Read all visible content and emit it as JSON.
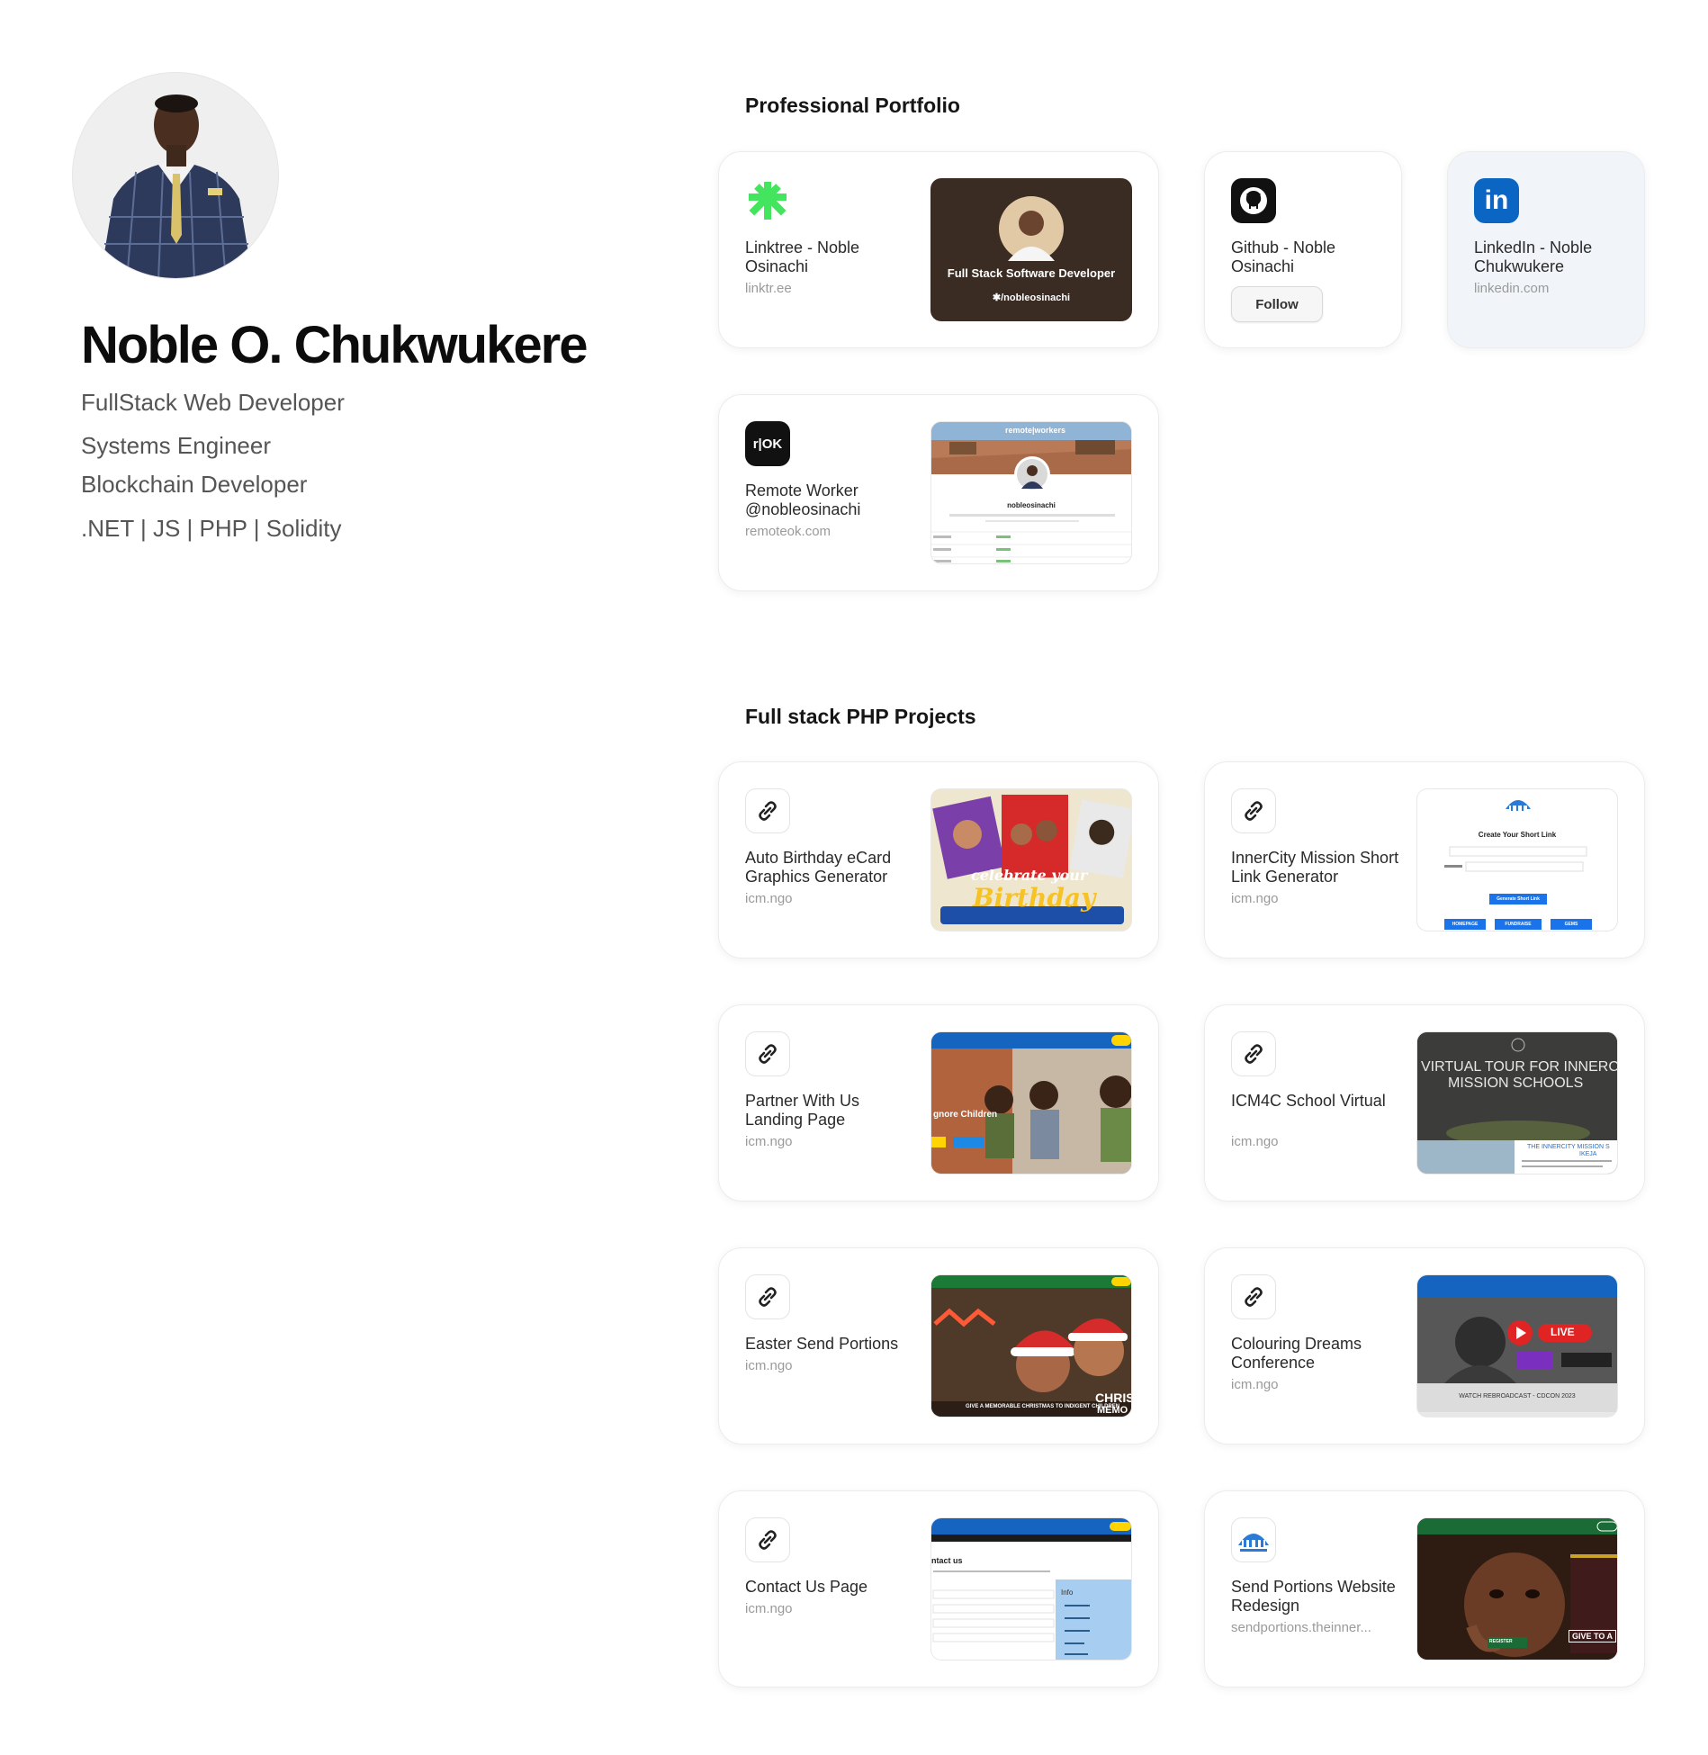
{
  "profile": {
    "name": "Noble O. Chukwukere",
    "bio": [
      "FullStack Web Developer",
      "Systems Engineer",
      "Blockchain Developer",
      ".NET | JS | PHP | Solidity"
    ]
  },
  "sections": {
    "portfolio_title": "Professional Portfolio",
    "php_title": "Full stack PHP Projects"
  },
  "portfolio": [
    {
      "title": "Linktree - Noble Osinachi",
      "domain": "linktr.ee",
      "icon": "linktree-icon",
      "thumb_text": [
        "Full Stack Software Developer",
        "✱/nobleosinachi"
      ]
    },
    {
      "title": "Github - Noble Osinachi",
      "icon": "github-icon",
      "button": "Follow"
    },
    {
      "title": "LinkedIn - Noble Chukwukere",
      "domain": "linkedin.com",
      "icon": "linkedin-icon",
      "icon_text": "in"
    },
    {
      "title": "Remote Worker @nobleosinachi",
      "domain": "remoteok.com",
      "icon": "remoteok-icon",
      "icon_text": "r|OK",
      "thumb_text": [
        "remote|workers",
        "nobleosinachi"
      ]
    }
  ],
  "projects": [
    {
      "title": "Auto Birthday eCard Graphics Generator",
      "domain": "icm.ngo",
      "icon": "link-icon",
      "thumb_text": [
        "celebrate your",
        "Birthday"
      ]
    },
    {
      "title": "InnerCity Mission Short Link Generator",
      "domain": "icm.ngo",
      "icon": "link-icon",
      "thumb_text": [
        "Create Your Short Link",
        "Generate Short Link",
        "HOMEPAGE",
        "FUNDRAISE",
        "GEMS"
      ]
    },
    {
      "title": "Partner With Us Landing Page",
      "domain": "icm.ngo",
      "icon": "link-icon",
      "thumb_text": [
        "gnore Children"
      ]
    },
    {
      "title": "ICM4C School Virtual",
      "domain": "icm.ngo",
      "icon": "link-icon",
      "thumb_text": [
        "VIRTUAL TOUR FOR INNERC",
        "MISSION SCHOOLS",
        "THE INNERCITY MISSION S",
        "IKEJA"
      ]
    },
    {
      "title": "Easter Send Portions",
      "domain": "icm.ngo",
      "icon": "link-icon",
      "thumb_text": [
        "GIVE A MEMORABLE CHRISTMAS TO INDIGENT CHILDREN",
        "CHRIS",
        "MEMO"
      ]
    },
    {
      "title": "Colouring Dreams Conference",
      "domain": "icm.ngo",
      "icon": "link-icon",
      "thumb_text": [
        "LIVE",
        "WATCH REBROADCAST - CDCON 2023"
      ]
    },
    {
      "title": "Contact Us Page",
      "domain": "icm.ngo",
      "icon": "link-icon",
      "thumb_text": [
        "ntact us",
        "Info"
      ]
    },
    {
      "title": "Send Portions Website Redesign",
      "domain": "sendportions.theinner...",
      "icon": "send-portions-logo-icon",
      "thumb_text": [
        "GIVE TO A",
        "REGISTER"
      ]
    }
  ],
  "colors": {
    "linktree_green": "#43e55e",
    "linkedin_blue": "#0a66c2",
    "tinted_card": "#f1f5f9",
    "icm_blue": "#1f6fd1",
    "icm_yellow": "#ffd400"
  }
}
